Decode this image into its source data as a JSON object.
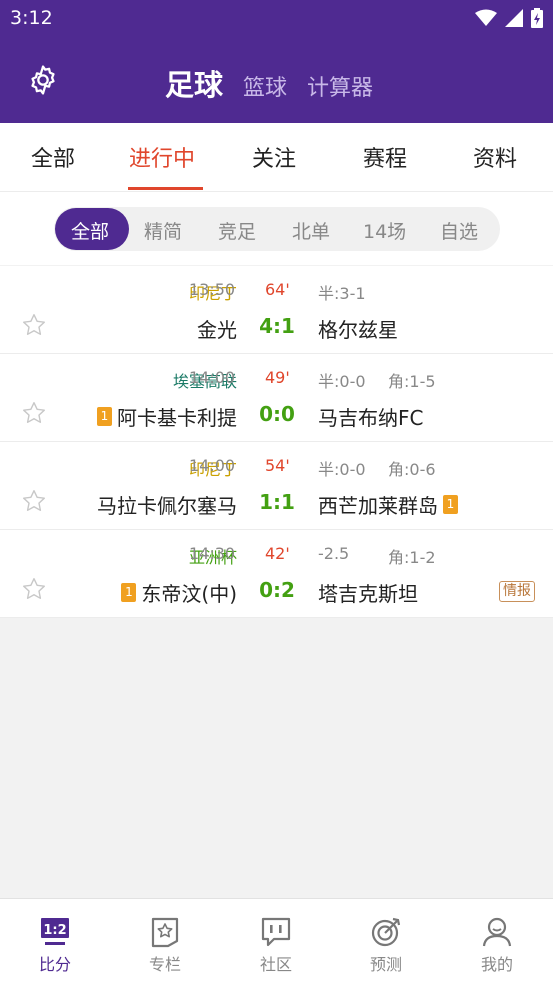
{
  "status": {
    "time": "3:12"
  },
  "header": {
    "sport_tabs": [
      {
        "label": "足球",
        "active": true
      },
      {
        "label": "篮球",
        "active": false
      },
      {
        "label": "计算器",
        "active": false
      }
    ]
  },
  "tabs": [
    {
      "label": "全部"
    },
    {
      "label": "进行中",
      "active": true
    },
    {
      "label": "关注"
    },
    {
      "label": "赛程"
    },
    {
      "label": "资料"
    }
  ],
  "filters": [
    {
      "label": "全部",
      "active": true
    },
    {
      "label": "精简"
    },
    {
      "label": "竞足"
    },
    {
      "label": "北单"
    },
    {
      "label": "14场"
    },
    {
      "label": "自选"
    }
  ],
  "matches": [
    {
      "league": "印尼丁",
      "league_color": "#c9a000",
      "time": "13:50",
      "minute": "64'",
      "half": "半:3-1",
      "corner": "",
      "home": "金光",
      "home_badge": "",
      "score": "4:1",
      "away": "格尔兹星",
      "away_badge": "",
      "tag": ""
    },
    {
      "league": "埃塞高联",
      "league_color": "#1a7a66",
      "time": "14:00",
      "minute": "49'",
      "half": "半:0-0",
      "corner": "角:1-5",
      "home": "阿卡基卡利提",
      "home_badge": "1",
      "score": "0:0",
      "away": "马吉布纳FC",
      "away_badge": "",
      "tag": ""
    },
    {
      "league": "印尼丁",
      "league_color": "#c9a000",
      "time": "14:00",
      "minute": "54'",
      "half": "半:0-0",
      "corner": "角:0-6",
      "home": "马拉卡佩尔塞马",
      "home_badge": "",
      "score": "1:1",
      "away": "西芒加莱群岛",
      "away_badge": "1",
      "tag": ""
    },
    {
      "league": "亚洲杯",
      "league_color": "#43a012",
      "time": "14:30",
      "minute": "42'",
      "half": "-2.5",
      "corner": "角:1-2",
      "home": "东帝汶(中)",
      "home_badge": "1",
      "score": "0:2",
      "away": "塔吉克斯坦",
      "away_badge": "",
      "tag": "情报"
    }
  ],
  "bottom_nav": [
    {
      "label": "比分",
      "icon": "scoreboard-icon",
      "active": true
    },
    {
      "label": "专栏",
      "icon": "column-icon"
    },
    {
      "label": "社区",
      "icon": "community-icon"
    },
    {
      "label": "预测",
      "icon": "target-icon"
    },
    {
      "label": "我的",
      "icon": "profile-icon"
    }
  ],
  "colors": {
    "brand": "#4f2a91",
    "accent_red": "#e0462c",
    "score_green": "#43a012"
  }
}
